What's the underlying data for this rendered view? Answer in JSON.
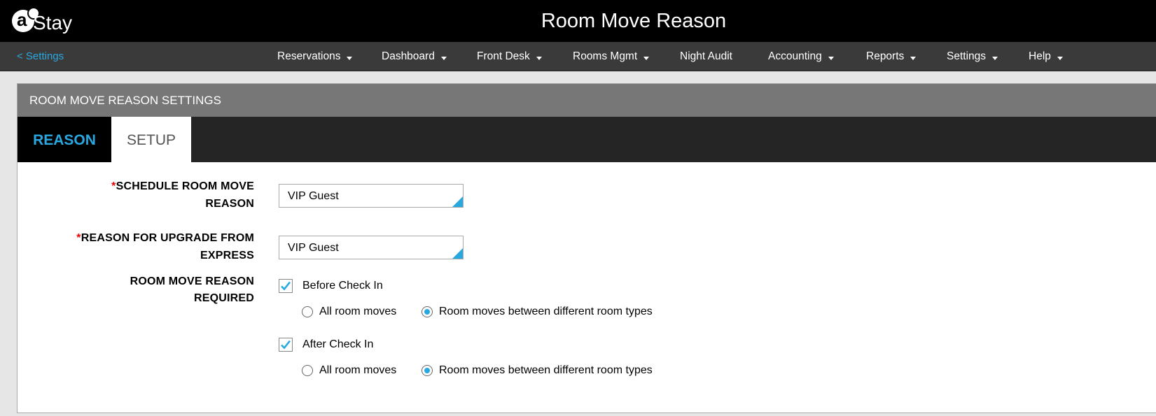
{
  "app": {
    "logo_text": "Stay",
    "title": "Room Move Reason"
  },
  "nav": {
    "back_label": "< Settings",
    "items": [
      {
        "label": "Reservations",
        "dropdown": true
      },
      {
        "label": "Dashboard",
        "dropdown": true
      },
      {
        "label": "Front Desk",
        "dropdown": true
      },
      {
        "label": "Rooms Mgmt",
        "dropdown": true
      },
      {
        "label": "Night Audit",
        "dropdown": false
      },
      {
        "label": "Accounting",
        "dropdown": true
      },
      {
        "label": "Reports",
        "dropdown": true
      },
      {
        "label": "Settings",
        "dropdown": true
      },
      {
        "label": "Help",
        "dropdown": true
      }
    ]
  },
  "panel": {
    "header": "ROOM MOVE REASON SETTINGS",
    "tabs": [
      {
        "label": "REASON",
        "active": false
      },
      {
        "label": "SETUP",
        "active": true
      }
    ]
  },
  "form": {
    "required_mark": "*",
    "schedule_label_line1": "SCHEDULE ROOM MOVE",
    "schedule_label_line2": "REASON",
    "schedule_value": "VIP Guest",
    "upgrade_label_line1": "REASON FOR UPGRADE FROM",
    "upgrade_label_line2": "EXPRESS",
    "upgrade_value": "VIP Guest",
    "required_label_line1": "ROOM MOVE REASON",
    "required_label_line2": "REQUIRED",
    "before": {
      "label": "Before Check In",
      "checked": true,
      "option_all": "All room moves",
      "option_different": "Room moves between different room types",
      "selected": "different"
    },
    "after": {
      "label": "After Check In",
      "checked": true,
      "option_all": "All room moves",
      "option_different": "Room moves between different room types",
      "selected": "different"
    }
  },
  "colors": {
    "accent": "#29a8e0",
    "required": "#e00000",
    "topbar": "#000000",
    "navbar": "#3a3a3a",
    "panel_header": "#777777"
  }
}
